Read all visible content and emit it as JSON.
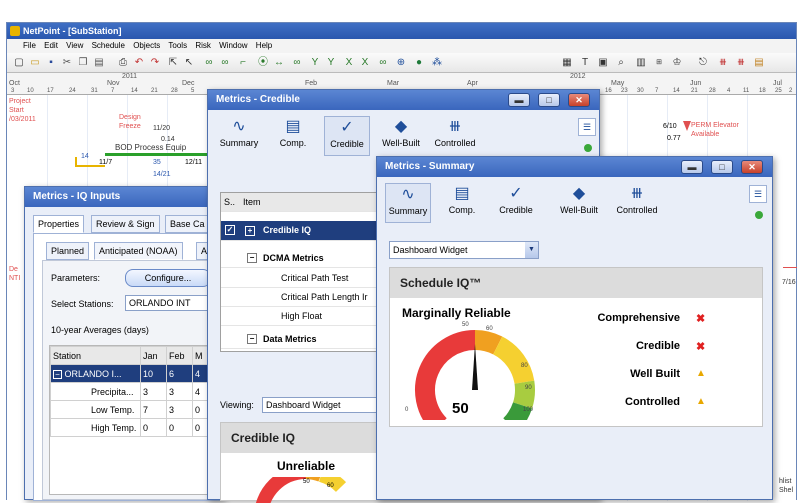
{
  "main": {
    "title": "NetPoint - [SubStation]",
    "menu": [
      "File",
      "Edit",
      "View",
      "Schedule",
      "Objects",
      "Tools",
      "Risk",
      "Window",
      "Help"
    ],
    "years": [
      "2011",
      "2012"
    ],
    "months": [
      "Oct",
      "Nov",
      "Dec",
      "Feb",
      "Mar",
      "Apr",
      "May",
      "Jun",
      "Jul"
    ],
    "days": [
      "3",
      "10",
      "17",
      "24",
      "31",
      "7",
      "14",
      "21",
      "28",
      "5",
      "16",
      "23",
      "30",
      "7",
      "14",
      "21",
      "28",
      "4",
      "11",
      "18",
      "25",
      "2"
    ],
    "gantt": {
      "project_start": "Project\nStart\n/03/2011",
      "design_freeze": "Design\nFreeze",
      "bod": "BOD Process Equip",
      "d1": "11/20",
      "d2": "0.14",
      "d3": "11/7",
      "d4": "35",
      "d5": "12/11",
      "d6": "14/21",
      "perm": "PERM Elevator\nAvailable",
      "perm_date": "6/10",
      "perm_val": "0.77",
      "right1": "7/16",
      "right2": "hlist\nShel",
      "left_red": "De\nNTI",
      "num14": "14"
    }
  },
  "iq_inputs": {
    "title": "Metrics - IQ Inputs",
    "tabs": [
      "Properties",
      "Review & Sign",
      "Base Ca"
    ],
    "subtabs": [
      "Planned",
      "Anticipated (NOAA)",
      "Ac"
    ],
    "parameters_label": "Parameters:",
    "configure_label": "Configure...",
    "stations_label": "Select Stations:",
    "stations_value": "ORLANDO INT",
    "averages_label": "10-year Averages (days)",
    "columns": [
      "Station",
      "Jan",
      "Feb",
      "M"
    ],
    "rows": [
      {
        "name": "ORLANDO I...",
        "jan": "10",
        "feb": "6",
        "m": "4"
      },
      {
        "name": "Precipita...",
        "jan": "3",
        "feb": "3",
        "m": "4"
      },
      {
        "name": "Low Temp.",
        "jan": "7",
        "feb": "3",
        "m": "0"
      },
      {
        "name": "High Temp.",
        "jan": "0",
        "feb": "0",
        "m": "0"
      }
    ]
  },
  "credible": {
    "title": "Metrics - Credible",
    "ribbon": [
      "Summary",
      "Comp.",
      "Credible",
      "Well-Built",
      "Controlled"
    ],
    "grid_header": [
      "S..",
      "Item"
    ],
    "rows": [
      "Credible IQ",
      "DCMA Metrics",
      "Critical Path Test",
      "Critical Path Length Ir",
      "High Float",
      "Data Metrics"
    ],
    "viewing_label": "Viewing:",
    "viewing_value": "Dashboard Widget",
    "widget_title": "Credible IQ",
    "status": "Unreliable",
    "g50": "50",
    "g60": "60"
  },
  "summary": {
    "title": "Metrics - Summary",
    "ribbon": [
      "Summary",
      "Comp.",
      "Credible",
      "Well-Built",
      "Controlled"
    ],
    "dropdown": "Dashboard Widget",
    "widget_title": "Schedule IQ™",
    "status": "Marginally Reliable",
    "gauge_value": "50",
    "gauge_ticks": [
      "0",
      "50",
      "60",
      "80",
      "90",
      "100"
    ],
    "criteria": [
      {
        "label": "Comprehensive",
        "status": "fail"
      },
      {
        "label": "Credible",
        "status": "fail"
      },
      {
        "label": "Well Built",
        "status": "warn"
      },
      {
        "label": "Controlled",
        "status": "warn"
      }
    ],
    "colors": {
      "fail": "#e02020",
      "warn": "#e8a800"
    }
  }
}
